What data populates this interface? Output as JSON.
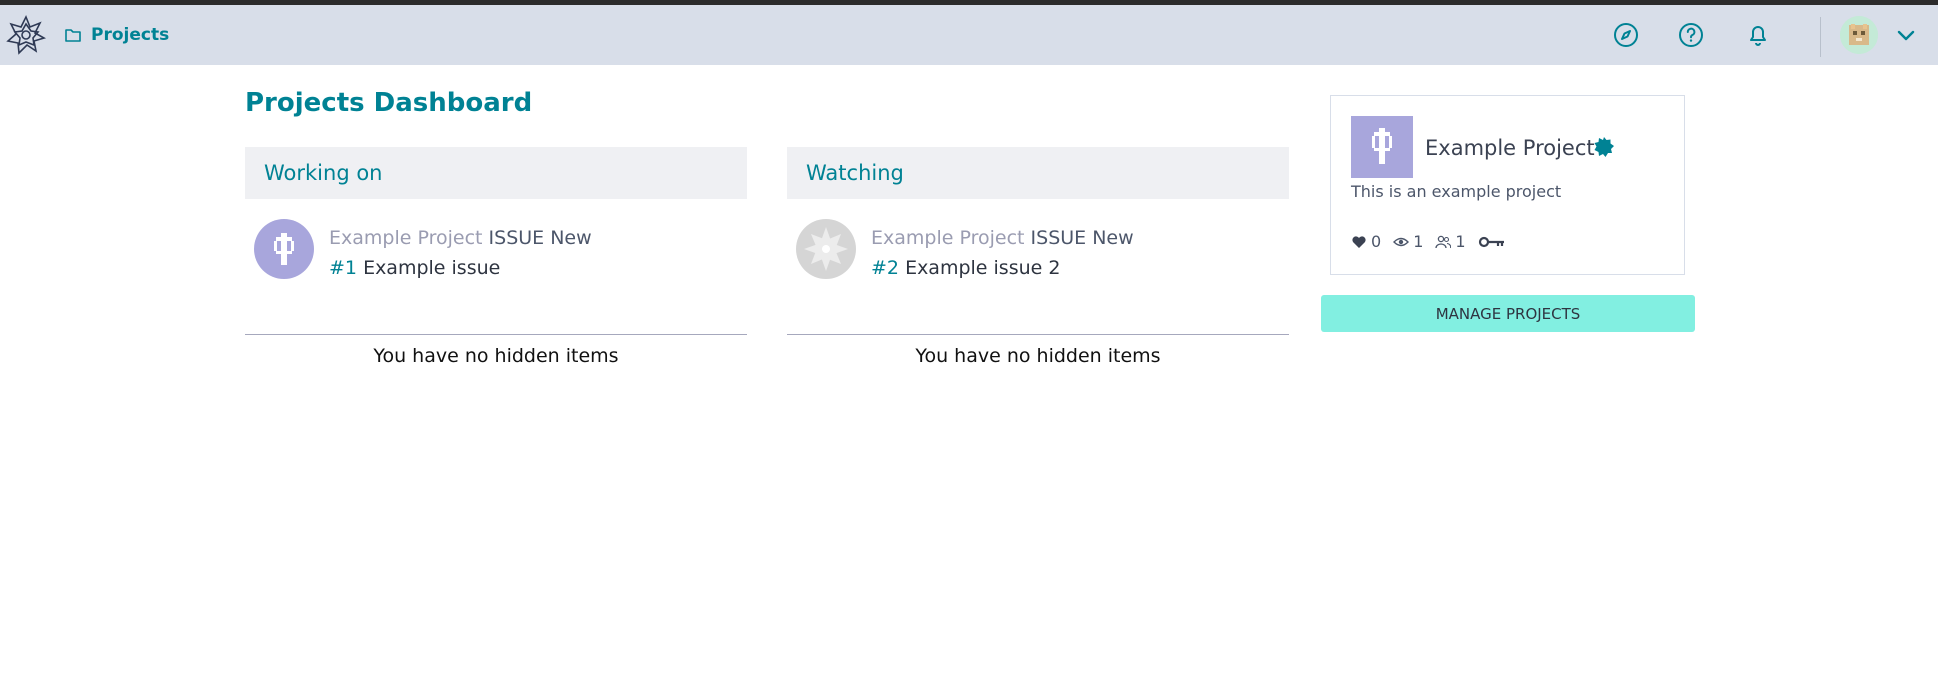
{
  "navbar": {
    "projects_label": "Projects",
    "icons": [
      "logo-icon",
      "folder-icon",
      "explore-icon",
      "help-icon",
      "notifications-icon",
      "user-avatar",
      "chevron-down-icon"
    ]
  },
  "page_title": "Projects Dashboard",
  "working_on": {
    "header": "Working on",
    "items": [
      {
        "project": "Example Project",
        "type": "ISSUE",
        "status": "New",
        "number": "#1",
        "title": "Example issue"
      }
    ],
    "no_hidden": "You have no hidden items"
  },
  "watching": {
    "header": "Watching",
    "items": [
      {
        "project": "Example Project",
        "type": "ISSUE",
        "status": "New",
        "number": "#2",
        "title": "Example issue 2"
      }
    ],
    "no_hidden": "You have no hidden items"
  },
  "project_card": {
    "title": "Example Project",
    "description": "This is an example project",
    "stats": {
      "likes": "0",
      "watchers": "1",
      "members": "1"
    }
  },
  "manage_button": "MANAGE PROJECTS",
  "colors": {
    "accent": "#008294",
    "navbar_bg": "#d8dee9",
    "button_bg": "#82efe1",
    "avatar_purple": "#a8a6dc"
  }
}
